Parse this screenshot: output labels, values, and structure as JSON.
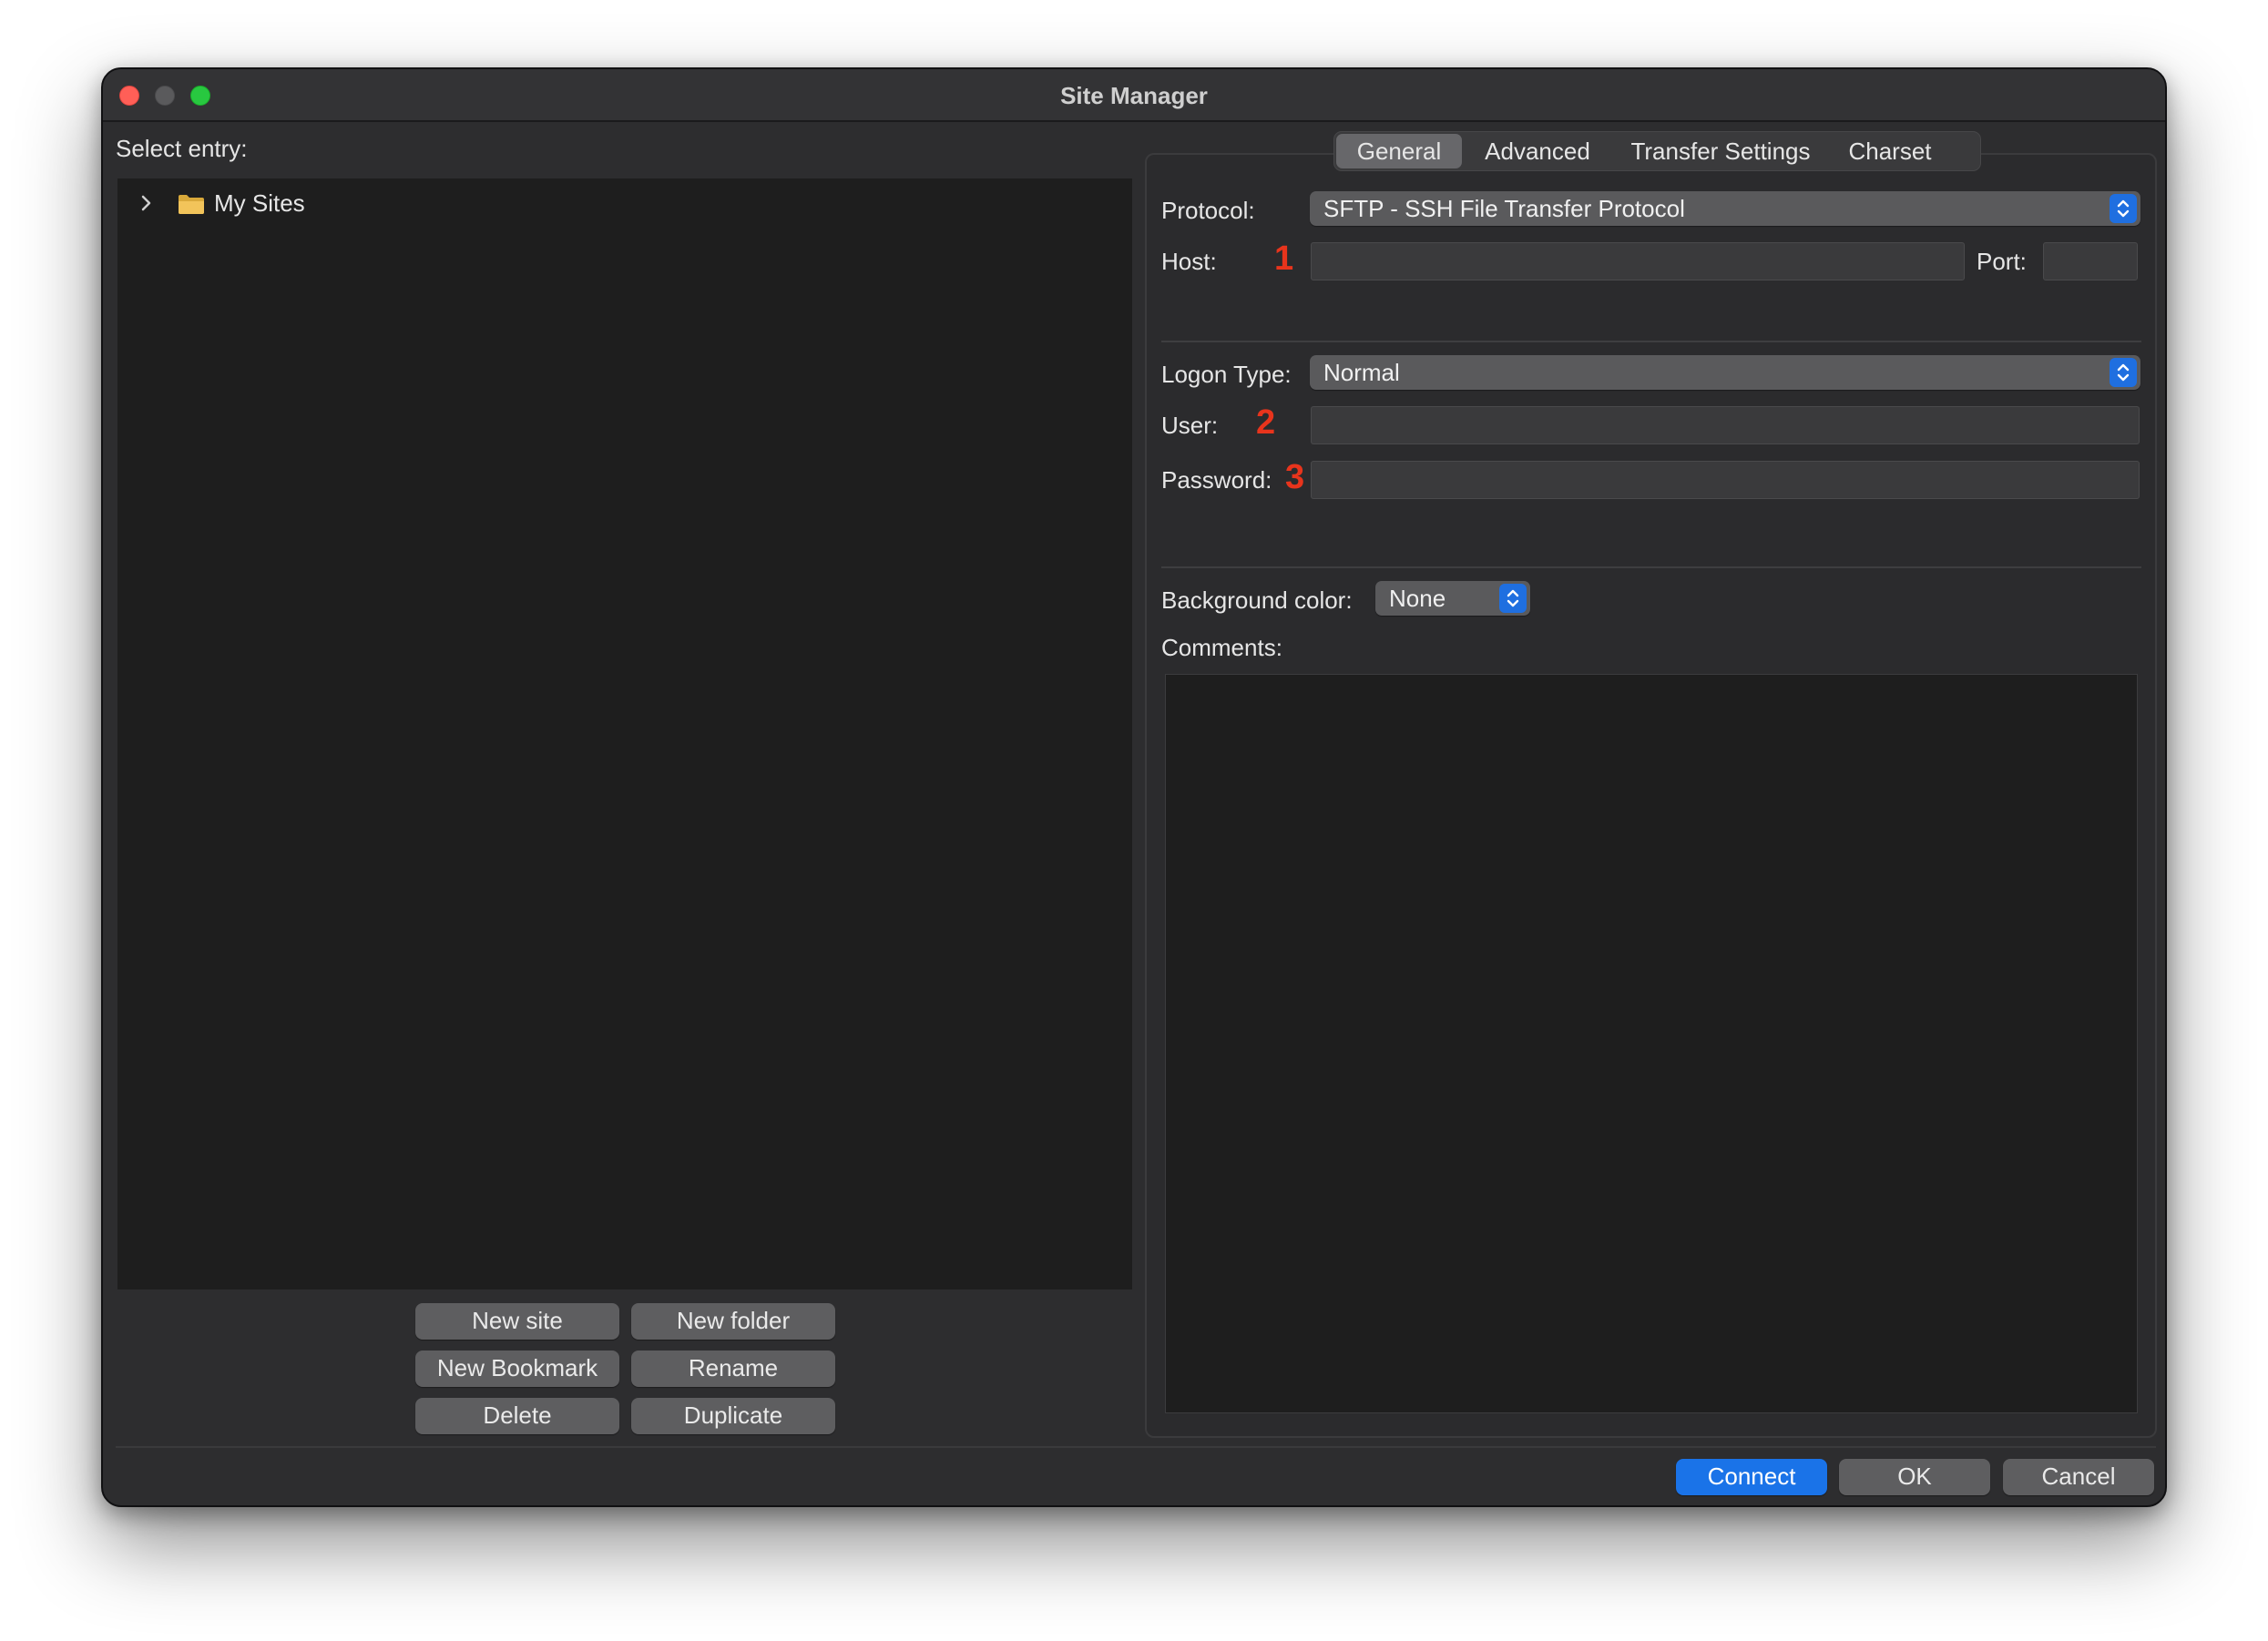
{
  "window": {
    "title": "Site Manager"
  },
  "left": {
    "select_entry_label": "Select entry:",
    "tree": {
      "items": [
        {
          "label": "My Sites",
          "icon": "folder-icon",
          "expander": "chevron-right-icon"
        }
      ]
    },
    "buttons": {
      "new_site": "New site",
      "new_folder": "New folder",
      "new_bookmark": "New Bookmark",
      "rename": "Rename",
      "delete": "Delete",
      "duplicate": "Duplicate"
    }
  },
  "tabs": [
    {
      "label": "General",
      "selected": true
    },
    {
      "label": "Advanced",
      "selected": false
    },
    {
      "label": "Transfer Settings",
      "selected": false
    },
    {
      "label": "Charset",
      "selected": false
    }
  ],
  "general": {
    "protocol_label": "Protocol:",
    "protocol_value": "SFTP - SSH File Transfer Protocol",
    "host_label": "Host:",
    "host_value": "",
    "port_label": "Port:",
    "port_value": "",
    "logon_type_label": "Logon Type:",
    "logon_type_value": "Normal",
    "user_label": "User:",
    "user_value": "",
    "password_label": "Password:",
    "password_value": "",
    "background_color_label": "Background color:",
    "background_color_value": "None",
    "comments_label": "Comments:",
    "comments_value": ""
  },
  "annotations": {
    "marker_1": "1",
    "marker_2": "2",
    "marker_3": "3",
    "color": "#e8341c"
  },
  "footer": {
    "connect": "Connect",
    "ok": "OK",
    "cancel": "Cancel"
  },
  "colors": {
    "accent": "#1a73e8",
    "window_bg": "#2d2d2f",
    "tree_bg": "#1e1e1e"
  }
}
